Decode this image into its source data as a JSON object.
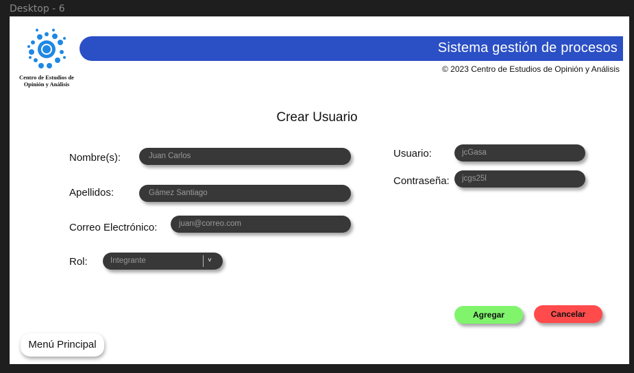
{
  "frame": {
    "label": "Desktop - 6"
  },
  "logo": {
    "line1": "Centro de Estudios de",
    "line2": "Opinión y Análisis"
  },
  "header": {
    "title": "Sistema gestión de procesos",
    "copyright": "© 2023 Centro de Estudios de Opinión y Análisis"
  },
  "page": {
    "title": "Crear Usuario"
  },
  "form": {
    "nombre": {
      "label": "Nombre(s):",
      "value": "Juan Carlos"
    },
    "apellidos": {
      "label": "Apellidos:",
      "value": "Gámez Santiago"
    },
    "correo": {
      "label": "Correo Electrónico:",
      "value": "juan@correo.com"
    },
    "rol": {
      "label": "Rol:",
      "selected": "Integrante",
      "chevron": "˅"
    },
    "usuario": {
      "label": "Usuario:",
      "value": "jcGasa"
    },
    "contrasena": {
      "label": "Contraseña:",
      "value": "jcgs25l"
    }
  },
  "actions": {
    "agregar": "Agregar",
    "cancelar": "Cancelar",
    "menu": "Menú Principal"
  },
  "colors": {
    "header_blue": "#2b4fc4",
    "logo_blue": "#1e88e5",
    "field_bg": "#383838",
    "agregar_green": "#80f56c",
    "cancelar_red": "#ff4b4b"
  }
}
